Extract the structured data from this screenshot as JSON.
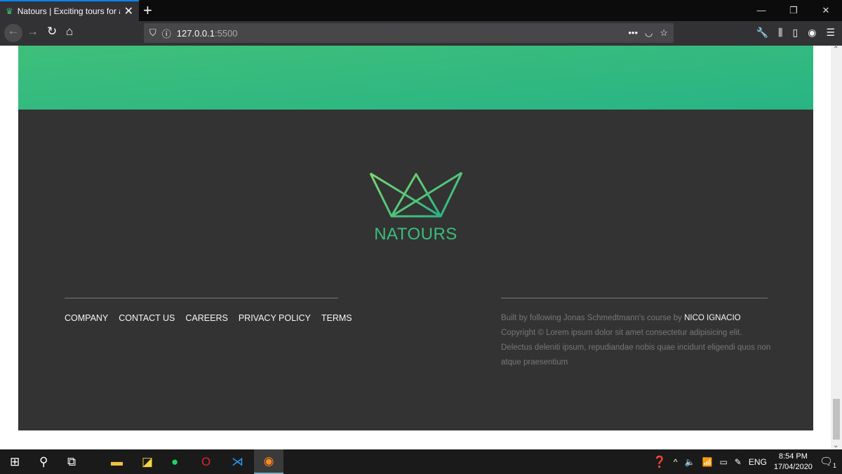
{
  "browser": {
    "tab_title": "Natours | Exciting tours for adv",
    "url_host": "127.0.0.1",
    "url_port": ":5500"
  },
  "footer": {
    "brand": "NATOURS",
    "nav": [
      "COMPANY",
      "CONTACT US",
      "CAREERS",
      "PRIVACY POLICY",
      "TERMS"
    ],
    "credit_prefix": "Built by following Jonas Schmedtmann's course by ",
    "credit_name": "NICO IGNACIO",
    "copyright": " Copyright © Lorem ipsum dolor sit amet consectetur adipisicing elit. Delectus deleniti ipsum, repudiandae nobis quae incidunt eligendi quos non atque praesentium"
  },
  "colors": {
    "accent_green": "#28b485",
    "accent_light": "#7ed56f",
    "footer_bg": "#333333"
  },
  "taskbar": {
    "lang": "ENG",
    "time": "8:54 PM",
    "date": "17/04/2020",
    "notifications": "1"
  }
}
